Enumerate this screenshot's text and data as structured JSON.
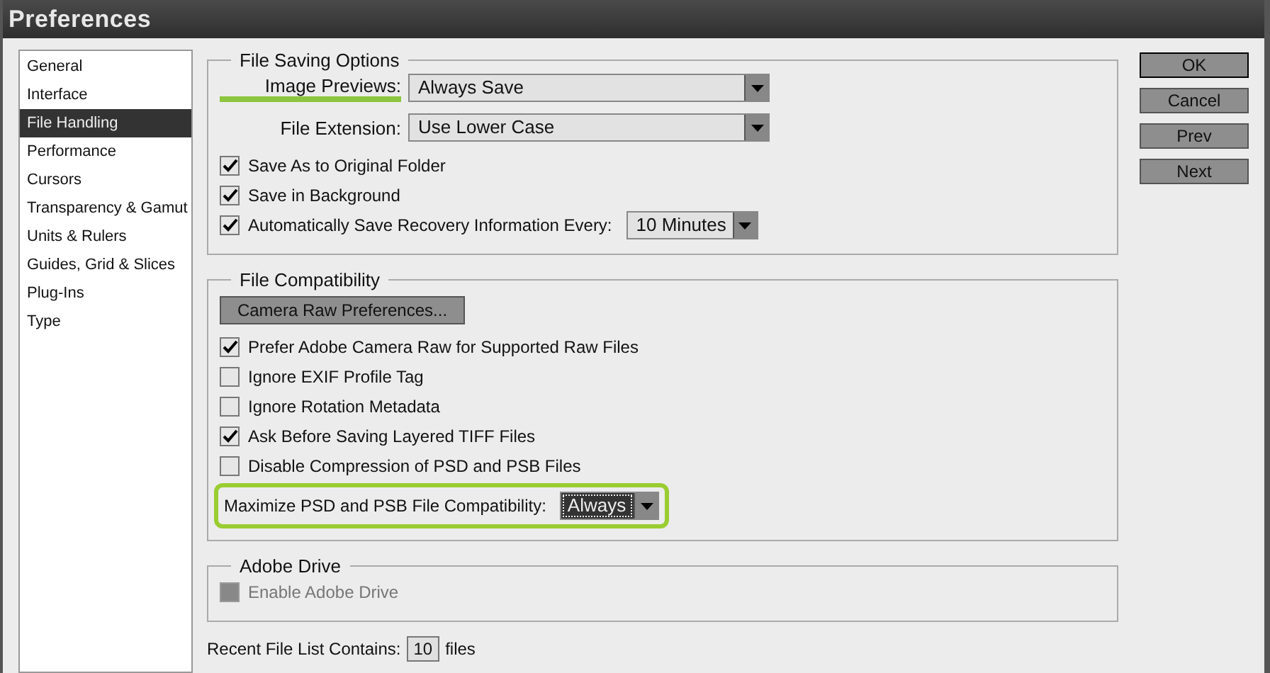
{
  "window": {
    "title": "Preferences"
  },
  "sidebar": {
    "items": [
      {
        "label": "General",
        "selected": false
      },
      {
        "label": "Interface",
        "selected": false
      },
      {
        "label": "File Handling",
        "selected": true
      },
      {
        "label": "Performance",
        "selected": false
      },
      {
        "label": "Cursors",
        "selected": false
      },
      {
        "label": "Transparency & Gamut",
        "selected": false
      },
      {
        "label": "Units & Rulers",
        "selected": false
      },
      {
        "label": "Guides, Grid & Slices",
        "selected": false
      },
      {
        "label": "Plug-Ins",
        "selected": false
      },
      {
        "label": "Type",
        "selected": false
      }
    ]
  },
  "sections": [
    {
      "title": "File Saving Options",
      "items": [
        {
          "kind": "select",
          "label": "Image Previews:",
          "value": "Always Save",
          "highlighted": true
        },
        {
          "kind": "select",
          "label": "File Extension:",
          "value": "Use Lower Case",
          "highlighted": false
        },
        {
          "kind": "checkbox",
          "label": "Save As to Original Folder",
          "checked": true,
          "disabled": false
        },
        {
          "kind": "checkbox",
          "label": "Save in Background",
          "checked": true,
          "disabled": false
        },
        {
          "kind": "checkbox_select",
          "label": "Automatically Save Recovery Information Every:",
          "checked": true,
          "value": "10 Minutes"
        }
      ]
    },
    {
      "title": "File Compatibility",
      "items": [
        {
          "kind": "button",
          "label": "Camera Raw Preferences..."
        },
        {
          "kind": "checkbox",
          "label": "Prefer Adobe Camera Raw for Supported Raw Files",
          "checked": true,
          "disabled": false
        },
        {
          "kind": "checkbox",
          "label": "Ignore EXIF Profile Tag",
          "checked": false,
          "disabled": false
        },
        {
          "kind": "checkbox",
          "label": "Ignore Rotation Metadata",
          "checked": false,
          "disabled": false
        },
        {
          "kind": "checkbox",
          "label": "Ask Before Saving Layered TIFF Files",
          "checked": true,
          "disabled": false
        },
        {
          "kind": "checkbox",
          "label": "Disable Compression of PSD and PSB Files",
          "checked": false,
          "disabled": false
        },
        {
          "kind": "inline_select",
          "label": "Maximize PSD and PSB File Compatibility:",
          "value": "Always",
          "focused": true,
          "highlighted": true
        }
      ]
    },
    {
      "title": "Adobe Drive",
      "items": [
        {
          "kind": "checkbox",
          "label": "Enable Adobe Drive",
          "checked": false,
          "disabled": true
        }
      ]
    }
  ],
  "recent_files": {
    "label": "Recent File List Contains:",
    "value": "10",
    "suffix": "files"
  },
  "buttons": [
    {
      "label": "OK",
      "default": true
    },
    {
      "label": "Cancel",
      "default": false
    },
    {
      "label": "Prev",
      "default": false
    },
    {
      "label": "Next",
      "default": false
    }
  ]
}
